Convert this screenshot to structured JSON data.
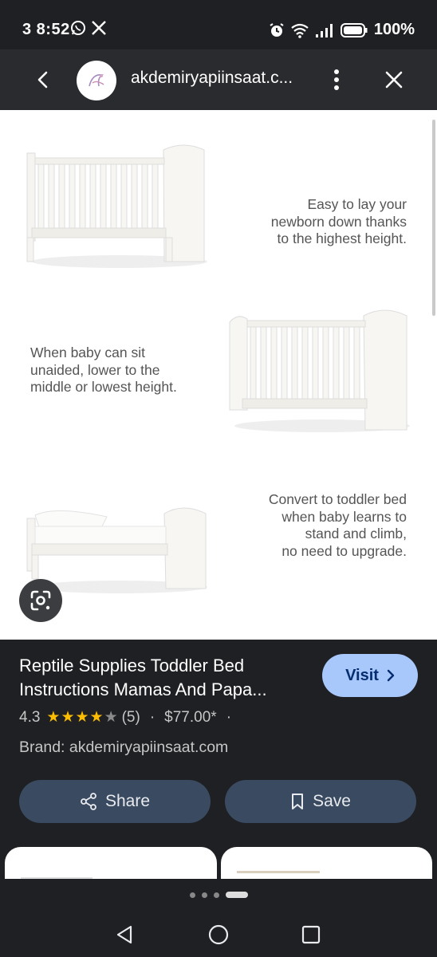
{
  "status_bar": {
    "time": "3 8:52",
    "battery": "100%",
    "icons": [
      "whatsapp-icon",
      "x-icon",
      "alarm-icon",
      "wifi-icon",
      "signal-icon",
      "battery-icon"
    ]
  },
  "top_bar": {
    "site_title": "akdemiryapiinsaat.c...",
    "icons": [
      "back-icon",
      "site-logo",
      "more-vert-icon",
      "close-icon"
    ]
  },
  "image": {
    "captions": [
      [
        "Easy to lay your",
        "newborn down thanks",
        "to the highest height."
      ],
      [
        "When baby can sit",
        "unaided, lower to the",
        "middle or lowest height."
      ],
      [
        "Convert to toddler bed",
        "when baby learns to",
        "stand and climb,",
        "no need to upgrade."
      ]
    ],
    "lens_icon": "google-lens-icon"
  },
  "product": {
    "title_line1": "Reptile Supplies Toddler Bed",
    "title_line2": "Instructions Mamas And Papa...",
    "visit_label": "Visit",
    "rating": "4.3",
    "stars": "★★★★",
    "half_star": "★",
    "reviews": "(5)",
    "separator": "·",
    "price": "$77.00*",
    "trailing_separator": "·",
    "brand": "Brand: akdemiryapiinsaat.com",
    "share_label": "Share",
    "save_label": "Save"
  },
  "colors": {
    "background": "#1f2023",
    "top_bar": "#2a2b2e",
    "visit_button": "#a8c7fa",
    "action_button": "#3a4a61",
    "star": "#fbbc04"
  },
  "navigation": {
    "icons": [
      "nav-back-icon",
      "nav-home-icon",
      "nav-recents-icon"
    ]
  }
}
